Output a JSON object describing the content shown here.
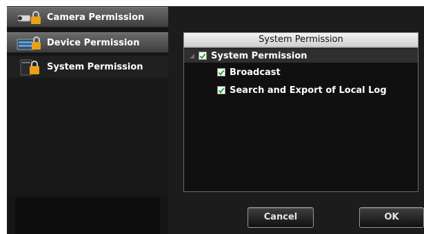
{
  "sidebar": {
    "items": [
      {
        "label": "Camera Permission",
        "icon": "camera-lock-icon"
      },
      {
        "label": "Device Permission",
        "icon": "device-lock-icon"
      },
      {
        "label": "System Permission",
        "icon": "system-lock-icon"
      }
    ]
  },
  "panel": {
    "header": "System Permission",
    "tree": {
      "root": {
        "label": "System Permission",
        "checked": true,
        "expanded": true
      },
      "children": [
        {
          "label": "Broadcast",
          "checked": true
        },
        {
          "label": "Search and Export of Local Log",
          "checked": true
        }
      ]
    }
  },
  "buttons": {
    "cancel": "Cancel",
    "ok": "OK"
  },
  "colors": {
    "check": "#1aa82a",
    "lock": "#e8a11a",
    "window_bg": "#151515"
  }
}
